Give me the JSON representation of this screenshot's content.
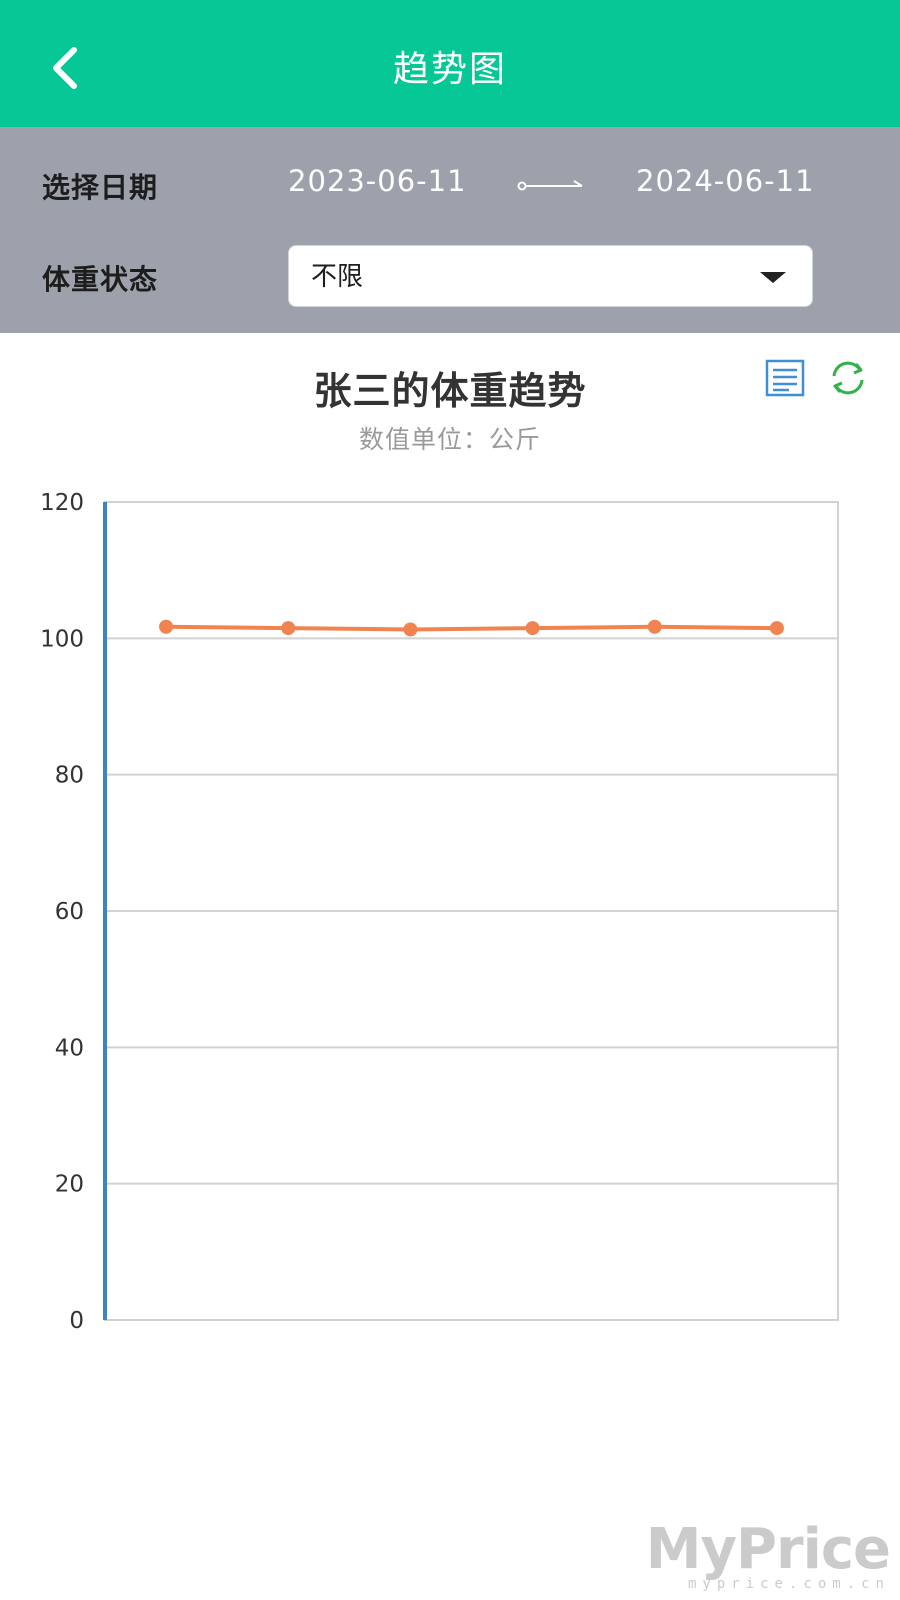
{
  "header": {
    "title": "趋势图",
    "back_icon": "chevron-left-icon",
    "background": "#05c896"
  },
  "filters": {
    "date_label": "选择日期",
    "start_date": "2023-06-11",
    "end_date": "2024-06-11",
    "status_label": "体重状态",
    "status_value": "不限"
  },
  "chart_header": {
    "title": "张三的体重趋势",
    "subtitle": "数值单位：公斤",
    "icons": [
      "list-icon",
      "refresh-icon"
    ]
  },
  "chart_data": {
    "type": "line",
    "title": "张三的体重趋势",
    "subtitle": "数值单位：公斤",
    "xlabel": "",
    "ylabel": "",
    "ylim": [
      0,
      120
    ],
    "yticks": [
      0,
      20,
      40,
      60,
      80,
      100,
      120
    ],
    "grid": true,
    "series": [
      {
        "values": [
          101.7,
          101.5,
          101.3,
          101.5,
          101.7,
          101.5
        ],
        "color": "#f0834f"
      }
    ],
    "y_axis_color": "#3d84c1"
  },
  "watermark": {
    "logo": "MyPrice",
    "url": "myprice.com.cn"
  }
}
